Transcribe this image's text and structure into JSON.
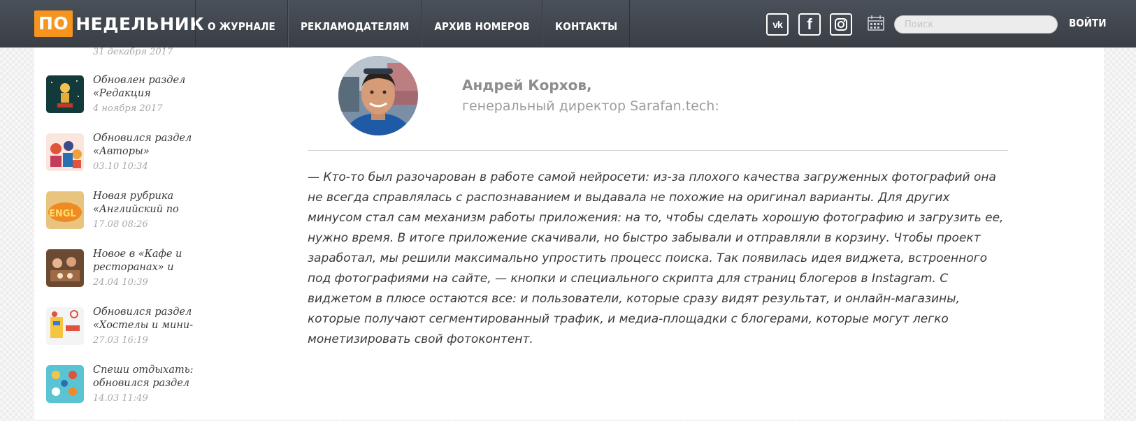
{
  "header": {
    "logo_part1": "ПО",
    "logo_part2": "НЕДЕЛЬНИК",
    "nav": [
      {
        "label": "О ЖУРНАЛЕ"
      },
      {
        "label": "РЕКЛАМОДАТЕЛЯМ"
      },
      {
        "label": "АРХИВ НОМЕРОВ"
      },
      {
        "label": "КОНТАКТЫ"
      }
    ],
    "social": {
      "vk": "vk",
      "facebook": "f",
      "instagram": "instagram-icon"
    },
    "search_placeholder": "Поиск",
    "login_label": "ВОЙТИ"
  },
  "sidebar": {
    "items": [
      {
        "title": "",
        "date": "31 декабря 2017",
        "thumb": "#a9c94a"
      },
      {
        "title": "Обновлен раздел «Редакция",
        "date": "4 ноября 2017",
        "thumb": "#123a3a"
      },
      {
        "title": "Обновился раздел «Авторы»",
        "date": "03.10 10:34",
        "thumb": "#f3d9d0"
      },
      {
        "title": "Новая рубрика «Английский по",
        "date": "17.08 08:26",
        "thumb": "#e4b25e"
      },
      {
        "title": "Новое в «Кафе и ресторанах» и",
        "date": "24.04 10:39",
        "thumb": "#8a5a3a"
      },
      {
        "title": "Обновился раздел «Хостелы и мини-",
        "date": "27.03 16:19",
        "thumb": "#f4f4f4"
      },
      {
        "title": "Спеши отдыхать: обновился раздел",
        "date": "14.03 11:49",
        "thumb": "#5bc4d4"
      }
    ]
  },
  "main": {
    "author_name": "Андрей Корхов,",
    "author_role": "генеральный директор Sarafan.tech:",
    "quote": "— Кто-то был разочарован в работе самой нейросети: из-за плохого качества загруженных фотографий она не всегда справлялась с распознаванием и выдавала не похожие на оригинал варианты. Для других минусом стал сам механизм работы приложения: на то, чтобы сделать хорошую фотографию и загрузить ее, нужно время. В итоге приложение скачивали, но быстро забывали и отправляли в корзину. Чтобы проект заработал, мы решили максимально упростить процесс поиска. Так появилась идея виджета, встроенного под фотографиями на сайте, — кнопки и специального скрипта для страниц блогеров в Instagram. С виджетом в плюсе остаются все: и пользователи, которые сразу видят результат, и онлайн-магазины, которые получают сегментированный трафик, и медиа-площадки с блогерами, которые могут легко монетизировать свой фотоконтент."
  },
  "colors": {
    "topbar": "#3f444b",
    "logo_accent": "#f7941d",
    "text": "#3a3a3a",
    "muted": "#a8a8a8"
  }
}
